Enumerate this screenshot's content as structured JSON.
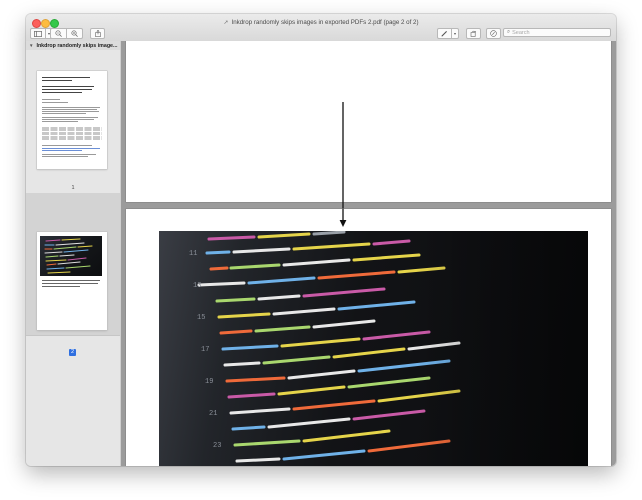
{
  "window": {
    "title": "Inkdrop randomly skips images in exported PDFs 2.pdf (page 2 of 2)",
    "doc_icon": "document-icon"
  },
  "toolbar": {
    "sidebar_toggle_icon": "sidebar-icon",
    "zoom_out_icon": "zoom-out-icon",
    "zoom_in_icon": "zoom-in-icon",
    "share_icon": "share-icon",
    "markup_icon": "pen-icon",
    "rotate_icon": "rotate-icon",
    "annotate_icon": "markup-circle-icon",
    "search_placeholder": "Search"
  },
  "sidebar": {
    "doc_title": "Inkdrop randomly skips image...",
    "pages": [
      {
        "number": "1",
        "selected": false
      },
      {
        "number": "2",
        "selected": true
      }
    ]
  },
  "colors": {
    "selection": "#2f6fe0",
    "content_bg": "#9b9b9b"
  }
}
